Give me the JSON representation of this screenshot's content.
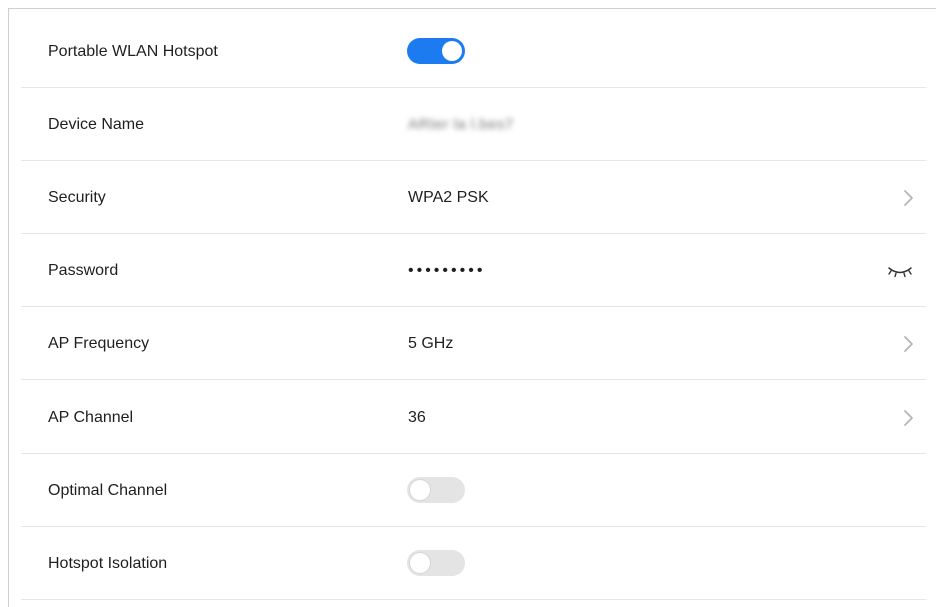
{
  "settings": {
    "hotspot": {
      "label": "Portable WLAN Hotspot",
      "enabled": true
    },
    "device_name": {
      "label": "Device Name",
      "value": "ARter la l.bes7"
    },
    "security": {
      "label": "Security",
      "value": "WPA2 PSK"
    },
    "password": {
      "label": "Password",
      "value": "•••••••••"
    },
    "ap_frequency": {
      "label": "AP Frequency",
      "value": "5 GHz"
    },
    "ap_channel": {
      "label": "AP Channel",
      "value": "36"
    },
    "optimal_channel": {
      "label": "Optimal Channel",
      "enabled": false
    },
    "hotspot_isolation": {
      "label": "Hotspot Isolation",
      "enabled": false
    }
  },
  "colors": {
    "toggle_on": "#1d7bf2",
    "toggle_off": "#e4e4e4",
    "divider": "#e6e6e6"
  },
  "icons": [
    "chevron-right-icon",
    "eye-closed-icon"
  ]
}
